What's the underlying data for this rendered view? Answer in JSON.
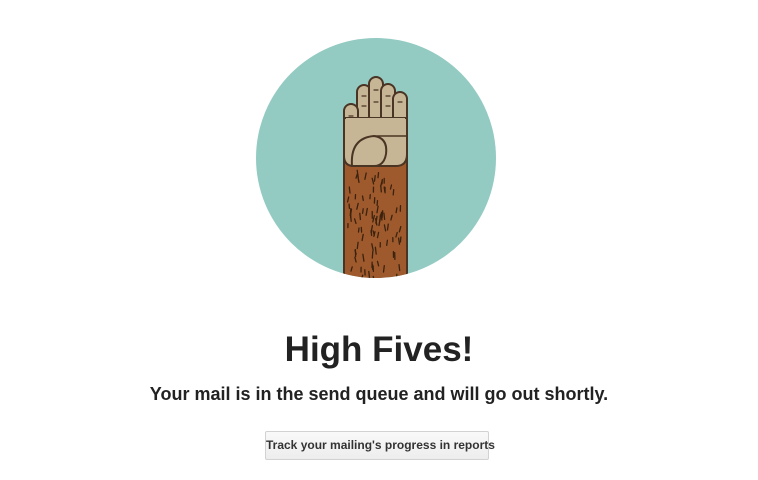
{
  "illustration": {
    "icon": "high-five-arm-icon",
    "circle_color": "#93cbc3",
    "palm_color": "#c7b696",
    "arm_color": "#9e5a2c",
    "outline_color": "#4a3424"
  },
  "confirmation": {
    "headline": "High Fives!",
    "message": "Your mail is in the send queue and will go out shortly."
  },
  "actions": {
    "track_button_label": "Track your mailing's progress in reports"
  }
}
